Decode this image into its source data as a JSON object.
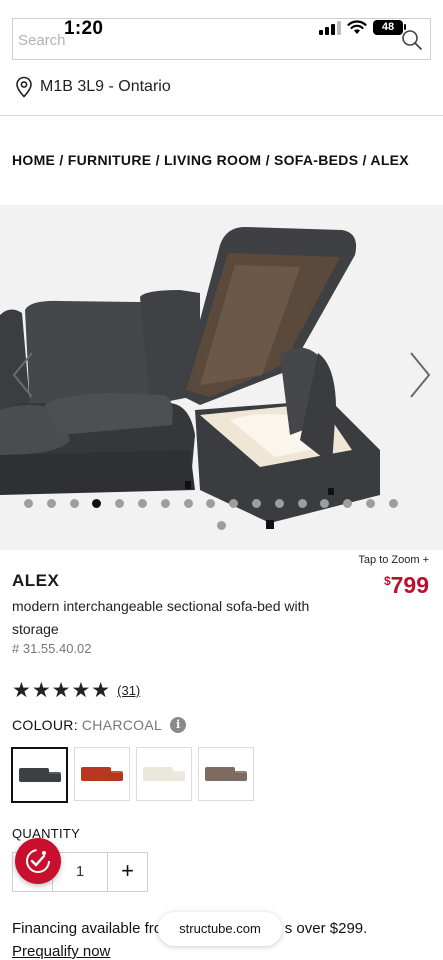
{
  "status_bar": {
    "time": "1:20",
    "battery": "48"
  },
  "search": {
    "placeholder": "Search",
    "icon": "search-icon"
  },
  "location": {
    "icon": "location-pin-icon",
    "text": "M1B 3L9 - Ontario"
  },
  "breadcrumb": {
    "items": [
      "HOME",
      "FURNITURE",
      "LIVING ROOM",
      "SOFA-BEDS",
      "ALEX"
    ],
    "separator": " / "
  },
  "gallery": {
    "image_count": 18,
    "active_index": 3,
    "prev_icon": "chevron-left-icon",
    "next_icon": "chevron-right-icon"
  },
  "product": {
    "zoom_hint": "Tap to Zoom +",
    "currency_symbol": "$",
    "price": "799",
    "name": "ALEX",
    "description": "modern interchangeable sectional sofa-bed with storage",
    "sku": "# 31.55.40.02",
    "stars": "★★★★★",
    "rating": 5,
    "review_count": "(31)",
    "price_color": "#b8102e"
  },
  "colour": {
    "label": "COLOUR:",
    "selected": "CHARCOAL",
    "info_icon": "i",
    "swatches": [
      {
        "name": "charcoal",
        "color": "#3d3f42"
      },
      {
        "name": "red",
        "color": "#b9361f"
      },
      {
        "name": "cream",
        "color": "#ece7dc"
      },
      {
        "name": "taupe",
        "color": "#7d6a60"
      }
    ]
  },
  "quantity": {
    "label": "QUANTITY",
    "value": "1",
    "plus": "+"
  },
  "financing": {
    "text": "Financing available from ",
    "text_tail": "s over $299.",
    "link": "Prequalify now"
  },
  "browser": {
    "url": "structube.com"
  }
}
